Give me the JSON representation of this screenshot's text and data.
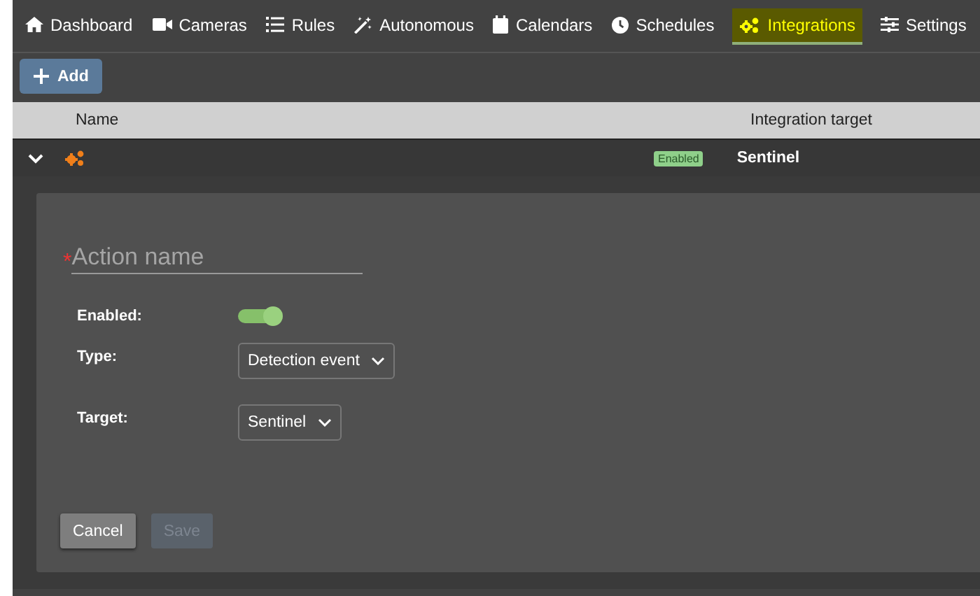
{
  "nav": {
    "tabs": [
      {
        "label": "Dashboard",
        "selected": false
      },
      {
        "label": "Cameras",
        "selected": false
      },
      {
        "label": "Rules",
        "selected": false
      },
      {
        "label": "Autonomous",
        "selected": false
      },
      {
        "label": "Calendars",
        "selected": false
      },
      {
        "label": "Schedules",
        "selected": false
      },
      {
        "label": "Integrations",
        "selected": true
      },
      {
        "label": "Settings",
        "selected": false
      }
    ]
  },
  "add_button": {
    "label": "Add"
  },
  "table": {
    "columns": [
      "Name",
      "Integration target"
    ],
    "rows": [
      {
        "expanded": true,
        "status": "Enabled",
        "target": "Sentinel"
      }
    ]
  },
  "form": {
    "name_field": {
      "required_mark": "*",
      "placeholder": "Action name"
    },
    "fields": [
      {
        "kind": "toggle",
        "label": "Enabled:",
        "on": true
      },
      {
        "kind": "select",
        "label": "Type:",
        "value": "Detection event"
      },
      {
        "kind": "select",
        "label": "Target:",
        "value": "Sentinel"
      }
    ],
    "buttons": [
      {
        "label": "Cancel",
        "disabled": false
      },
      {
        "label": "Save",
        "disabled": true
      }
    ]
  }
}
